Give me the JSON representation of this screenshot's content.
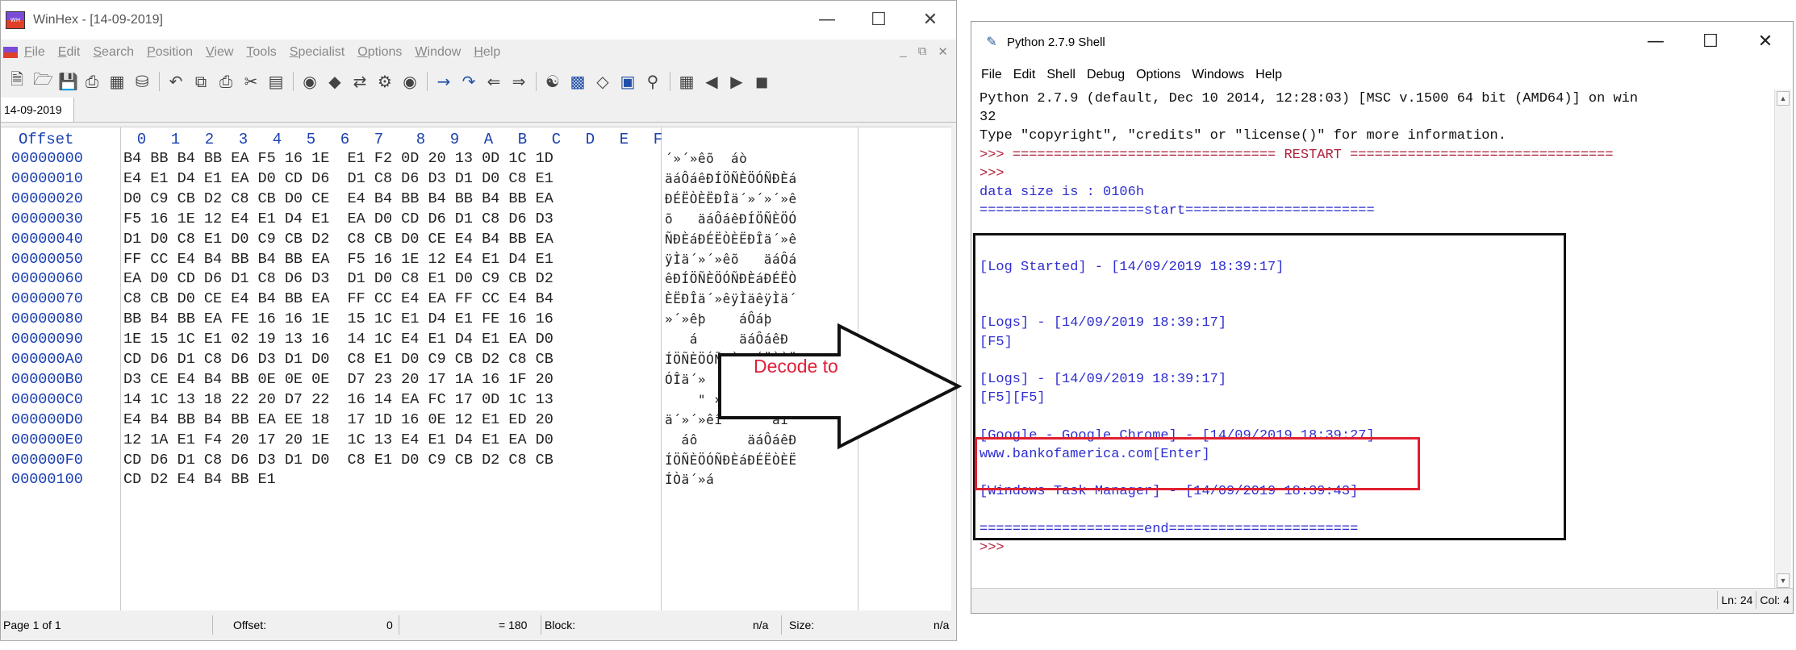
{
  "winhex": {
    "title": "WinHex - [14-09-2019]",
    "menu": [
      "File",
      "Edit",
      "Search",
      "Position",
      "View",
      "Tools",
      "Specialist",
      "Options",
      "Window",
      "Help"
    ],
    "tab": "14-09-2019",
    "header_offset": "Offset",
    "header_columns": [
      "0",
      "1",
      "2",
      "3",
      "4",
      "5",
      "6",
      "7",
      "8",
      "9",
      "A",
      "B",
      "C",
      "D",
      "E",
      "F"
    ],
    "rows": [
      {
        "offset": "00000000",
        "hex": "B4 BB B4 BB EA F5 16 1E  E1 F2 0D 20 13 0D 1C 1D",
        "text": "´»´»êõ  áò"
      },
      {
        "offset": "00000010",
        "hex": "E4 E1 D4 E1 EA D0 CD D6  D1 C8 D6 D3 D1 D0 C8 E1",
        "text": "äáÔáêÐÍÖÑÈÖÓÑÐÈá"
      },
      {
        "offset": "00000020",
        "hex": "D0 C9 CB D2 C8 CB D0 CE  E4 B4 BB B4 BB B4 BB EA",
        "text": "ÐÉËÒÈËÐÎä´»´»´»ê"
      },
      {
        "offset": "00000030",
        "hex": "F5 16 1E 12 E4 E1 D4 E1  EA D0 CD D6 D1 C8 D6 D3",
        "text": "õ   äáÔáêÐÍÖÑÈÖÓ"
      },
      {
        "offset": "00000040",
        "hex": "D1 D0 C8 E1 D0 C9 CB D2  C8 CB D0 CE E4 B4 BB EA",
        "text": "ÑÐÈáÐÉËÒÈËÐÎä´»ê"
      },
      {
        "offset": "00000050",
        "hex": "FF CC E4 B4 BB B4 BB EA  F5 16 1E 12 E4 E1 D4 E1",
        "text": "ÿÌä´»´»êõ   äáÔá"
      },
      {
        "offset": "00000060",
        "hex": "EA D0 CD D6 D1 C8 D6 D3  D1 D0 C8 E1 D0 C9 CB D2",
        "text": "êÐÍÖÑÈÖÓÑÐÈáÐÉËÒ"
      },
      {
        "offset": "00000070",
        "hex": "C8 CB D0 CE E4 B4 BB EA  FF CC E4 EA FF CC E4 B4",
        "text": "ÈËÐÎä´»êÿÌäêÿÌä´"
      },
      {
        "offset": "00000080",
        "hex": "BB B4 BB EA FE 16 16 1E  15 1C E1 D4 E1 FE 16 16",
        "text": "»´»êþ    áÔáþ"
      },
      {
        "offset": "00000090",
        "hex": "1E 15 1C E1 02 19 13 16  14 1C E4 E1 D4 E1 EA D0",
        "text": "   á     äáÔáêÐ"
      },
      {
        "offset": "000000A0",
        "hex": "CD D6 D1 C8 D6 D3 D1 D0  C8 E1 D0 C9 CB D2 C8 CB",
        "text": "ÍÖÑÈÖÓÑÐÈáÐÉËÒÈË"
      },
      {
        "offset": "000000B0",
        "hex": "D3 CE E4 B4 BB 0E 0E 0E  D7 23 20 17 1A 16 1F 20",
        "text": "ÓÎä´»   ×#"
      },
      {
        "offset": "000000C0",
        "hex": "14 1C 13 18 22 20 D7 22  16 14 EA FC 17 0D 1C 13",
        "text": "    \" ×\"  êü"
      },
      {
        "offset": "000000D0",
        "hex": "E4 B4 BB B4 BB EA EE 18  17 1D 16 0E 12 E1 ED 20",
        "text": "ä´»´»êî      áí"
      },
      {
        "offset": "000000E0",
        "hex": "12 1A E1 F4 20 17 20 1E  1C 13 E4 E1 D4 E1 EA D0",
        "text": "  áô      äáÔáêÐ"
      },
      {
        "offset": "000000F0",
        "hex": "CD D6 D1 C8 D6 D3 D1 D0  C8 E1 D0 C9 CB D2 C8 CB",
        "text": "ÍÖÑÈÖÓÑÐÈáÐÉËÒÈË"
      },
      {
        "offset": "00000100",
        "hex": "CD D2 E4 B4 BB E1",
        "text": "ÍÒä´»á"
      }
    ],
    "status": {
      "page": "Page 1 of 1",
      "offset_label": "Offset:",
      "offset_value": "0",
      "selection": "= 180",
      "block_label": "Block:",
      "block_value": "n/a",
      "size_label": "Size:",
      "size_value": "n/a"
    }
  },
  "arrow": {
    "label": "Decode to"
  },
  "python": {
    "title": "Python 2.7.9 Shell",
    "menu": [
      "File",
      "Edit",
      "Shell",
      "Debug",
      "Options",
      "Windows",
      "Help"
    ],
    "lines": [
      {
        "text": "Python 2.7.9 (default, Dec 10 2014, 12:28:03) [MSC v.1500 64 bit (AMD64)] on win",
        "style": "black"
      },
      {
        "text": "32",
        "style": "black"
      },
      {
        "text": "Type \"copyright\", \"credits\" or \"license()\" for more information.",
        "style": "black"
      },
      {
        "text": ">>> ================================ RESTART ================================",
        "style": "prompt"
      },
      {
        "text": ">>>",
        "style": "prompt"
      },
      {
        "text": "data size is : 0106h",
        "style": "blue"
      },
      {
        "text": "====================start=======================",
        "style": "blue"
      },
      {
        "text": "",
        "style": "blue"
      },
      {
        "text": "",
        "style": "blue"
      },
      {
        "text": "[Log Started] - [14/09/2019 18:39:17]",
        "style": "blue"
      },
      {
        "text": "",
        "style": "blue"
      },
      {
        "text": "",
        "style": "blue"
      },
      {
        "text": "[Logs] - [14/09/2019 18:39:17]",
        "style": "blue"
      },
      {
        "text": "[F5]",
        "style": "blue"
      },
      {
        "text": "",
        "style": "blue"
      },
      {
        "text": "[Logs] - [14/09/2019 18:39:17]",
        "style": "blue"
      },
      {
        "text": "[F5][F5]",
        "style": "blue"
      },
      {
        "text": "",
        "style": "blue"
      },
      {
        "text": "[Google - Google Chrome] - [14/09/2019 18:39:27]",
        "style": "blue"
      },
      {
        "text": "www.bankofamerica.com[Enter]",
        "style": "blue"
      },
      {
        "text": "",
        "style": "blue"
      },
      {
        "text": "[Windows Task Manager] - [14/09/2019 18:39:43]",
        "style": "blue"
      },
      {
        "text": "",
        "style": "blue"
      },
      {
        "text": "====================end=======================",
        "style": "blue"
      },
      {
        "text": ">>>",
        "style": "prompt"
      }
    ],
    "status_ln": "Ln: 24",
    "status_col": "Col: 4"
  }
}
